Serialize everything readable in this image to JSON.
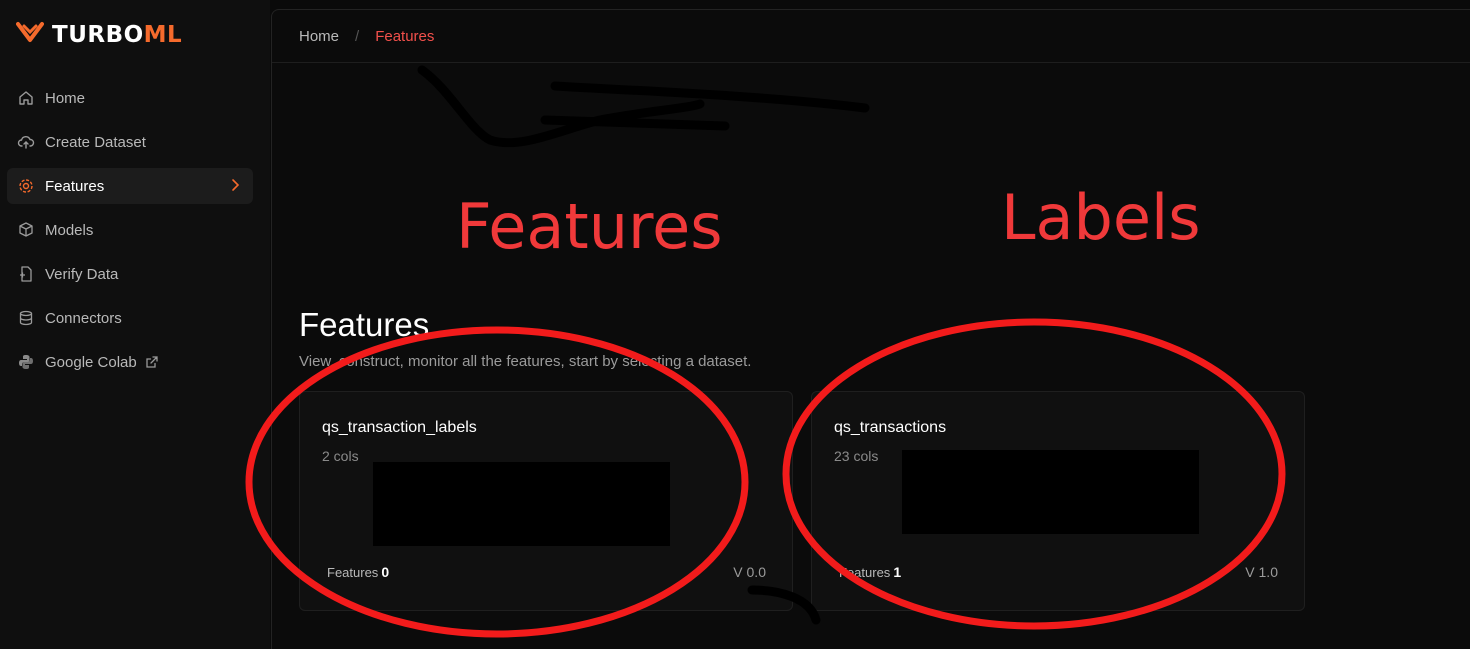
{
  "sidebar": {
    "logo": {
      "part1": "TURBO",
      "part2": "ML"
    },
    "items": [
      {
        "label": "Home",
        "icon": "home-icon",
        "active": false
      },
      {
        "label": "Create Dataset",
        "icon": "cloud-upload-icon",
        "active": false
      },
      {
        "label": "Features",
        "icon": "gear-icon",
        "active": true
      },
      {
        "label": "Models",
        "icon": "cube-icon",
        "active": false
      },
      {
        "label": "Verify Data",
        "icon": "file-check-icon",
        "active": false
      },
      {
        "label": "Connectors",
        "icon": "database-icon",
        "active": false
      },
      {
        "label": "Google Colab",
        "icon": "python-icon",
        "active": false
      }
    ]
  },
  "breadcrumb": {
    "home": "Home",
    "separator": "/",
    "current": "Features"
  },
  "page": {
    "title": "Features",
    "subtitle": "View, construct, monitor all the features, start by selecting a dataset."
  },
  "cards": [
    {
      "name": "qs_transaction_labels",
      "cols": "2 cols",
      "features_label": "Features",
      "features_count": "0",
      "version": "V 0.0"
    },
    {
      "name": "qs_transactions",
      "cols": "23 cols",
      "features_label": "Features",
      "features_count": "1",
      "version": "V 1.0"
    }
  ],
  "annotations": {
    "left_label": "Features",
    "right_label": "Labels"
  },
  "colors": {
    "accent": "#f56a2c",
    "annotation_red": "#f0393a",
    "breadcrumb_current": "#f2504b",
    "background": "#0a0a0a"
  }
}
